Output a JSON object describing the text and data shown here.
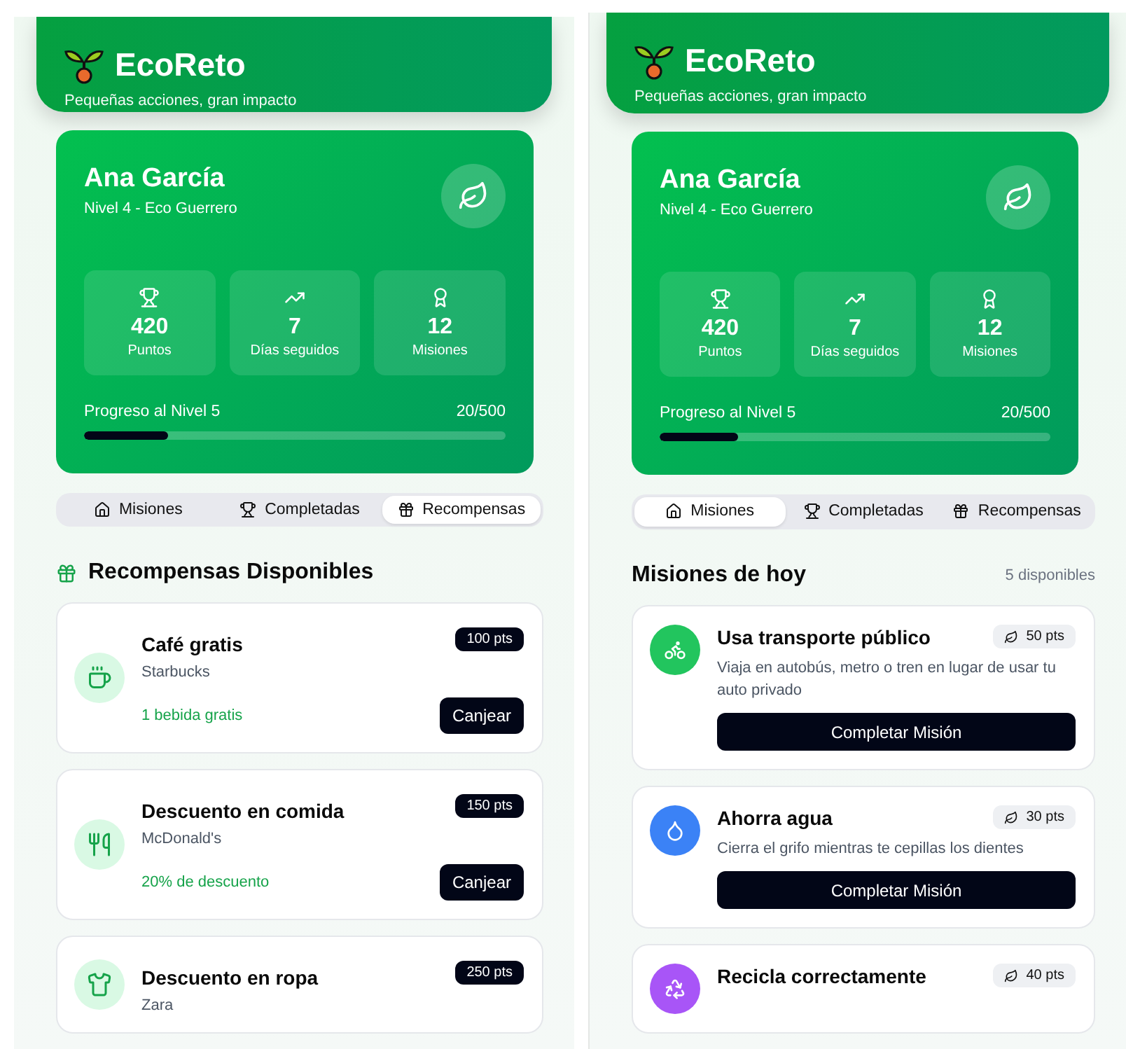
{
  "screens": [
    {
      "header": {
        "title": "EcoReto",
        "subtitle": "Pequeñas acciones, gran impacto"
      },
      "profile": {
        "name": "Ana García",
        "level_label": "Nivel 4 - Eco Guerrero",
        "stats": [
          {
            "value": "420",
            "label": "Puntos"
          },
          {
            "value": "7",
            "label": "Días seguidos"
          },
          {
            "value": "12",
            "label": "Misiones"
          }
        ],
        "progress": {
          "label": "Progreso al Nivel 5",
          "reading": "20/500",
          "level": 0.2
        }
      },
      "tabs": [
        {
          "label": "Misiones",
          "selected": false
        },
        {
          "label": "Completadas",
          "selected": false
        },
        {
          "label": "Recompensas",
          "selected": true
        }
      ],
      "section": {
        "kind": "rewards",
        "title": "Recompensas Disponibles",
        "items": [
          {
            "title": "Café gratis",
            "store": "Starbucks",
            "benefit": "1 bebida gratis",
            "points": "100 pts",
            "action": "Canjear"
          },
          {
            "title": "Descuento en comida",
            "store": "McDonald's",
            "benefit": "20% de descuento",
            "points": "150 pts",
            "action": "Canjear"
          },
          {
            "title": "Descuento en ropa",
            "store": "Zara",
            "points": "250 pts"
          }
        ]
      }
    },
    {
      "header": {
        "title": "EcoReto",
        "subtitle": "Pequeñas acciones, gran impacto"
      },
      "profile": {
        "name": "Ana García",
        "level_label": "Nivel 4 - Eco Guerrero",
        "stats": [
          {
            "value": "420",
            "label": "Puntos"
          },
          {
            "value": "7",
            "label": "Días seguidos"
          },
          {
            "value": "12",
            "label": "Misiones"
          }
        ],
        "progress": {
          "label": "Progreso al Nivel 5",
          "reading": "20/500",
          "level": 0.2
        }
      },
      "tabs": [
        {
          "label": "Misiones",
          "selected": true
        },
        {
          "label": "Completadas",
          "selected": false
        },
        {
          "label": "Recompensas",
          "selected": false
        }
      ],
      "section": {
        "kind": "missions",
        "title": "Misiones de hoy",
        "count": "5 disponibles",
        "items": [
          {
            "title": "Usa transporte público",
            "description": "Viaja en autobús, metro o tren en lugar de usar tu auto privado",
            "points": "50 pts",
            "action": "Completar Misión",
            "color": "#22c55e"
          },
          {
            "title": "Ahorra agua",
            "description": "Cierra el grifo mientras te cepillas los dientes",
            "points": "30 pts",
            "action": "Completar Misión",
            "color": "#3b82f6"
          },
          {
            "title": "Recicla correctamente",
            "points": "40 pts",
            "color": "#a855f7"
          }
        ]
      }
    }
  ]
}
